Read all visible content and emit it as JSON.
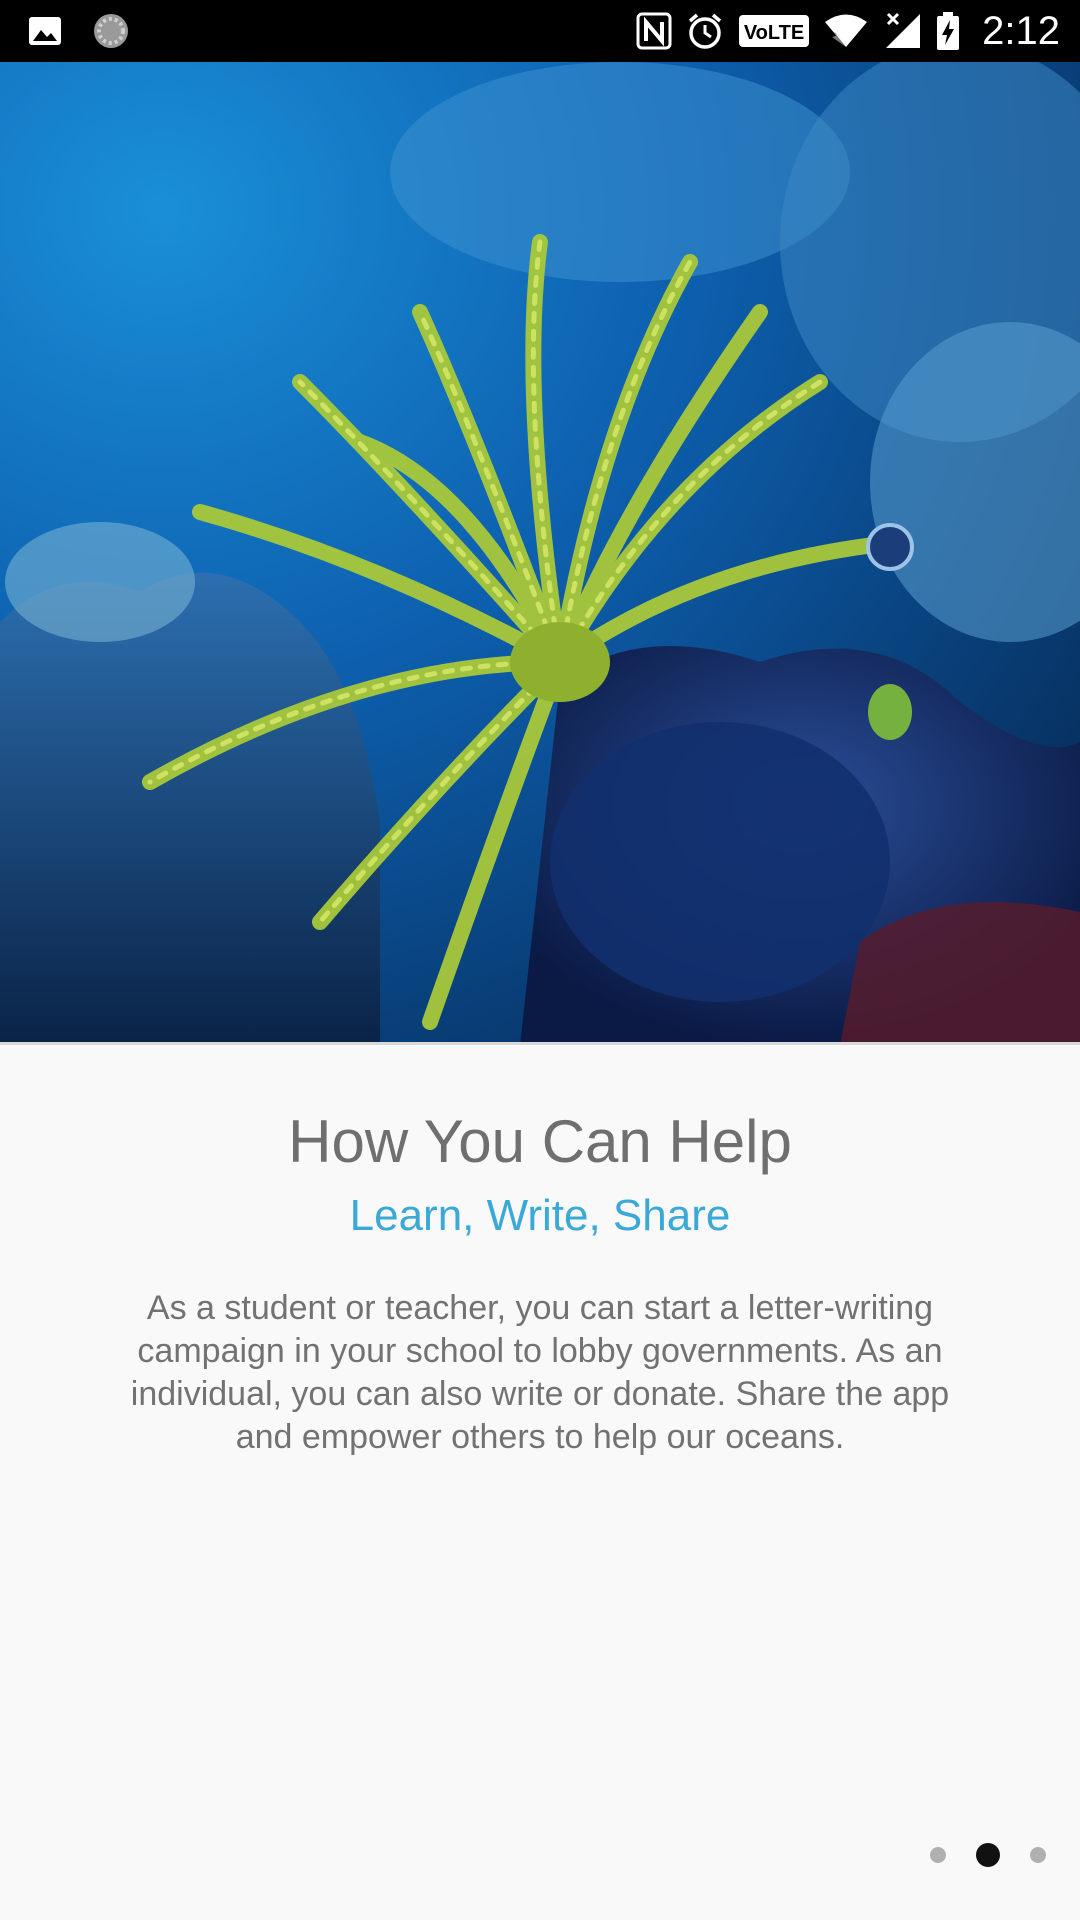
{
  "status_bar": {
    "time": "2:12",
    "left_icons": [
      "image-icon",
      "loading-spinner-icon"
    ],
    "right_icons": [
      "nfc-icon",
      "alarm-icon",
      "volte-icon",
      "wifi-icon",
      "signal-icon",
      "battery-charging-icon"
    ],
    "volte_label": "VoLTE"
  },
  "hero": {
    "image": "underwater-coral-reef-with-green-feather-star"
  },
  "onboarding": {
    "title": "How You Can Help",
    "subtitle": "Learn, Write, Share",
    "body": "As a student or teacher, you can start a letter-writing campaign in your school to lobby governments. As an individual, you can also write or donate. Share the app and empower others to help our oceans."
  },
  "pager": {
    "total": 3,
    "active_index": 1
  },
  "colors": {
    "accent": "#3aa9d8",
    "title": "#6f6f6f",
    "body": "#727272",
    "background": "#f9f9f9",
    "status_bar": "#000000"
  }
}
